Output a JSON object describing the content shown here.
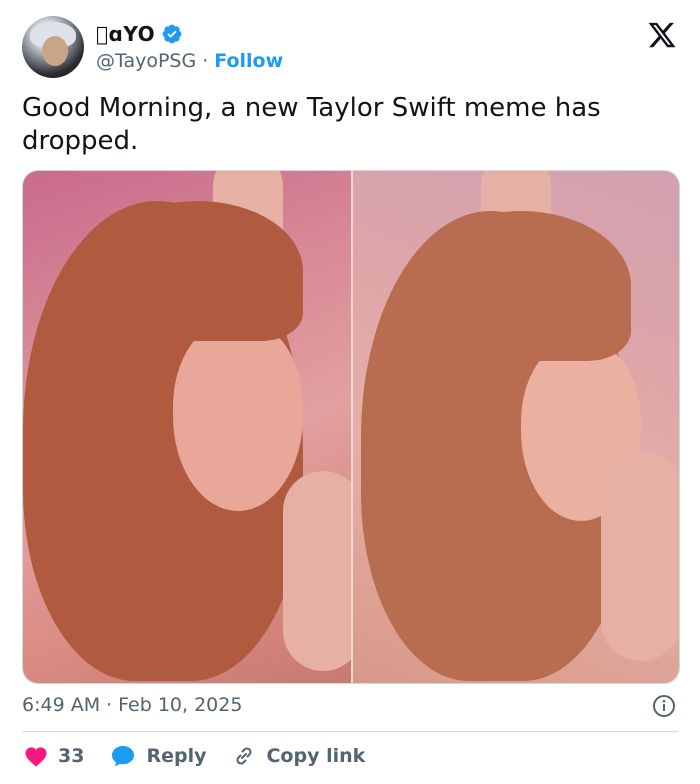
{
  "author": {
    "display_name": "\u0000ɑYO",
    "handle": "@TayoPSG",
    "dot": "·",
    "follow_label": "Follow"
  },
  "tweet": {
    "text": "Good Morning, a new Taylor Swift meme has dropped.",
    "time": "6:49 AM",
    "dot": "·",
    "date": "Feb 10, 2025"
  },
  "actions": {
    "like_count": "33",
    "reply_label": "Reply",
    "copy_label": "Copy link"
  },
  "icons": {
    "brand": "x-logo-icon",
    "verified": "verified-badge-icon",
    "info": "info-icon",
    "like": "heart-icon",
    "reply": "reply-bubble-icon",
    "copy": "link-icon"
  },
  "colors": {
    "accent": "#1d9bf0",
    "like": "#f91880",
    "muted": "#536471",
    "text": "#0f1419"
  }
}
